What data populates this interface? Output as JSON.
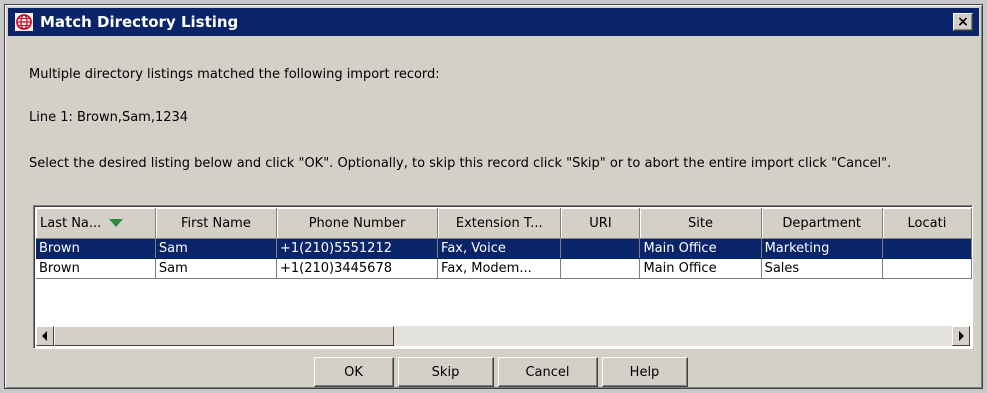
{
  "window": {
    "title": "Match Directory Listing",
    "close_label": "×"
  },
  "messages": {
    "line1": "Multiple directory listings matched the following import record:",
    "line2": "Line 1: Brown,Sam,1234",
    "line3": "Select the desired listing below and click \"OK\". Optionally, to skip this record click \"Skip\" or to abort the entire import click \"Cancel\"."
  },
  "table": {
    "columns": [
      "Last Na...",
      "First Name",
      "Phone Number",
      "Extension T...",
      "URI",
      "Site",
      "Department",
      "Locati"
    ],
    "sorted_column": "Last Na...",
    "sort_direction": "descending",
    "rows": [
      [
        "Brown",
        "Sam",
        "+1(210)5551212",
        "Fax, Voice",
        "",
        "Main Office",
        "Marketing",
        ""
      ],
      [
        "Brown",
        "Sam",
        "+1(210)3445678",
        "Fax, Modem...",
        "",
        "Main Office",
        "Sales",
        ""
      ]
    ],
    "selected_row": 0
  },
  "buttons": {
    "ok": "OK",
    "skip": "Skip",
    "cancel": "Cancel",
    "help": "Help"
  },
  "colors": {
    "titlebar": "#0a246a",
    "selection": "#0a246a",
    "face": "#d4d0c8",
    "sort_arrow": "#2e8b3c"
  },
  "icons": {
    "app": "globe-icon",
    "close": "close-icon",
    "sort": "sort-descending-icon",
    "scroll_left": "arrow-left-icon",
    "scroll_right": "arrow-right-icon"
  }
}
